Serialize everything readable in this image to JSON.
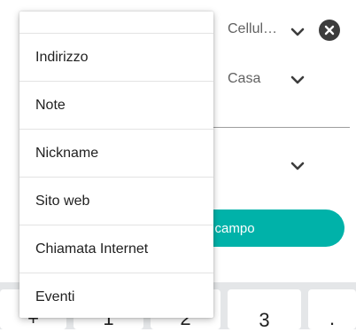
{
  "background": {
    "phone_type_label": "Cellul…",
    "home_type_label": "Casa",
    "add_field_label": "o campo",
    "accent_color": "#00b2a9"
  },
  "keyboard": {
    "keys": [
      "+",
      "1",
      "2",
      "3",
      "."
    ]
  },
  "menu": {
    "items": [
      {
        "label": ""
      },
      {
        "label": "Indirizzo"
      },
      {
        "label": "Note"
      },
      {
        "label": "Nickname"
      },
      {
        "label": "Sito web"
      },
      {
        "label": "Chiamata Internet"
      },
      {
        "label": "Eventi"
      }
    ]
  },
  "icons": {
    "dropdown": "chevron-down-icon",
    "clear": "close-circle-icon"
  }
}
